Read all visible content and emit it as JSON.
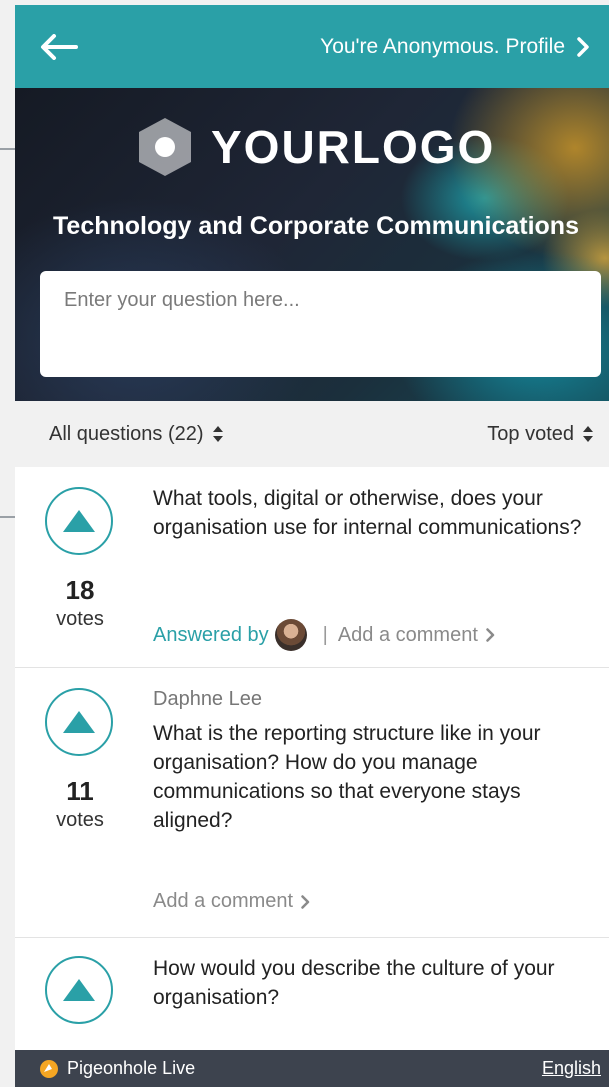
{
  "topbar": {
    "profile_text": "You're Anonymous. Profile"
  },
  "hero": {
    "logo_text": "YOURLOGO",
    "title": "Technology and Corporate Communications",
    "question_placeholder": "Enter your question here..."
  },
  "filters": {
    "questions_filter": "All questions (22)",
    "sort_by": "Top voted"
  },
  "questions": [
    {
      "author": "",
      "text": "What tools, digital or otherwise, does your organisation use for internal communications?",
      "votes": "18",
      "votes_label": "votes",
      "answered_label": "Answered by",
      "comment_label": "Add a comment"
    },
    {
      "author": "Daphne Lee",
      "text": "What is the reporting structure like in your organisation? How do you manage communications so that everyone stays aligned?",
      "votes": "11",
      "votes_label": "votes",
      "comment_label": "Add a comment"
    },
    {
      "author": "",
      "text": "How would you describe the culture of your organisation?"
    }
  ],
  "footer": {
    "brand": "Pigeonhole Live",
    "language": "English"
  },
  "colors": {
    "accent": "#2aa0a7",
    "footer_bg": "#3d434e"
  }
}
